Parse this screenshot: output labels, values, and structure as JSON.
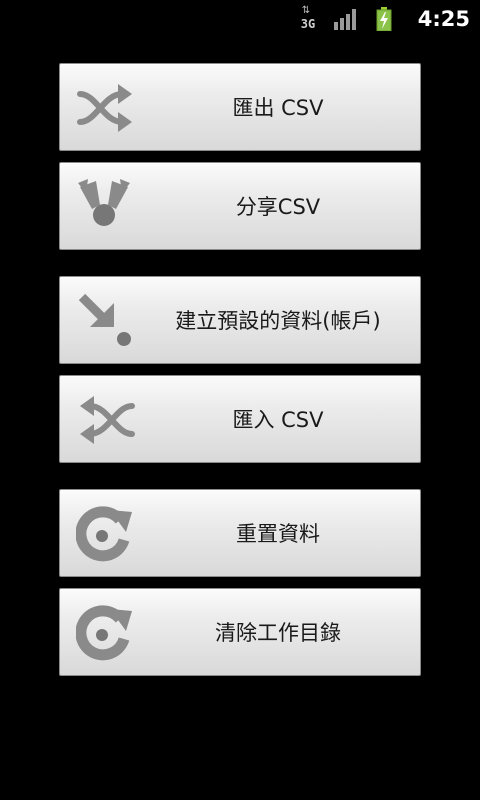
{
  "status_bar": {
    "network_type": "3G",
    "time": "4:25"
  },
  "menu": {
    "items": [
      {
        "label": "匯出 CSV",
        "icon": "shuffle-icon"
      },
      {
        "label": "分享CSV",
        "icon": "share-icon"
      },
      {
        "label": "建立預設的資料(帳戶)",
        "icon": "arrow-dot-icon"
      },
      {
        "label": "匯入 CSV",
        "icon": "shuffle-reverse-icon"
      },
      {
        "label": "重置資料",
        "icon": "reset-icon"
      },
      {
        "label": "清除工作目錄",
        "icon": "reset-icon"
      }
    ]
  },
  "colors": {
    "background": "#000000",
    "button_top": "#fbfbfb",
    "button_bottom": "#d9d9d9",
    "icon_gray": "#8a8a8a"
  }
}
